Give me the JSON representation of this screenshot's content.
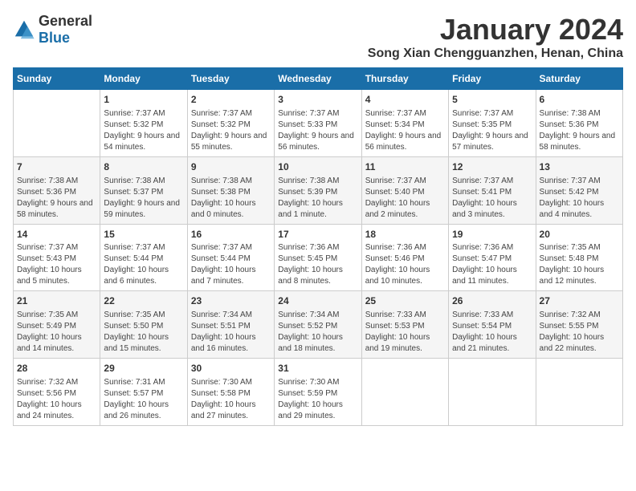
{
  "header": {
    "logo": {
      "general": "General",
      "blue": "Blue"
    },
    "month_year": "January 2024",
    "location": "Song Xian Chengguanzhen, Henan, China"
  },
  "days_of_week": [
    "Sunday",
    "Monday",
    "Tuesday",
    "Wednesday",
    "Thursday",
    "Friday",
    "Saturday"
  ],
  "weeks": [
    [
      {
        "day": "",
        "sunrise": "",
        "sunset": "",
        "daylight": ""
      },
      {
        "day": "1",
        "sunrise": "Sunrise: 7:37 AM",
        "sunset": "Sunset: 5:32 PM",
        "daylight": "Daylight: 9 hours and 54 minutes."
      },
      {
        "day": "2",
        "sunrise": "Sunrise: 7:37 AM",
        "sunset": "Sunset: 5:32 PM",
        "daylight": "Daylight: 9 hours and 55 minutes."
      },
      {
        "day": "3",
        "sunrise": "Sunrise: 7:37 AM",
        "sunset": "Sunset: 5:33 PM",
        "daylight": "Daylight: 9 hours and 56 minutes."
      },
      {
        "day": "4",
        "sunrise": "Sunrise: 7:37 AM",
        "sunset": "Sunset: 5:34 PM",
        "daylight": "Daylight: 9 hours and 56 minutes."
      },
      {
        "day": "5",
        "sunrise": "Sunrise: 7:37 AM",
        "sunset": "Sunset: 5:35 PM",
        "daylight": "Daylight: 9 hours and 57 minutes."
      },
      {
        "day": "6",
        "sunrise": "Sunrise: 7:38 AM",
        "sunset": "Sunset: 5:36 PM",
        "daylight": "Daylight: 9 hours and 58 minutes."
      }
    ],
    [
      {
        "day": "7",
        "sunrise": "Sunrise: 7:38 AM",
        "sunset": "Sunset: 5:36 PM",
        "daylight": "Daylight: 9 hours and 58 minutes."
      },
      {
        "day": "8",
        "sunrise": "Sunrise: 7:38 AM",
        "sunset": "Sunset: 5:37 PM",
        "daylight": "Daylight: 9 hours and 59 minutes."
      },
      {
        "day": "9",
        "sunrise": "Sunrise: 7:38 AM",
        "sunset": "Sunset: 5:38 PM",
        "daylight": "Daylight: 10 hours and 0 minutes."
      },
      {
        "day": "10",
        "sunrise": "Sunrise: 7:38 AM",
        "sunset": "Sunset: 5:39 PM",
        "daylight": "Daylight: 10 hours and 1 minute."
      },
      {
        "day": "11",
        "sunrise": "Sunrise: 7:37 AM",
        "sunset": "Sunset: 5:40 PM",
        "daylight": "Daylight: 10 hours and 2 minutes."
      },
      {
        "day": "12",
        "sunrise": "Sunrise: 7:37 AM",
        "sunset": "Sunset: 5:41 PM",
        "daylight": "Daylight: 10 hours and 3 minutes."
      },
      {
        "day": "13",
        "sunrise": "Sunrise: 7:37 AM",
        "sunset": "Sunset: 5:42 PM",
        "daylight": "Daylight: 10 hours and 4 minutes."
      }
    ],
    [
      {
        "day": "14",
        "sunrise": "Sunrise: 7:37 AM",
        "sunset": "Sunset: 5:43 PM",
        "daylight": "Daylight: 10 hours and 5 minutes."
      },
      {
        "day": "15",
        "sunrise": "Sunrise: 7:37 AM",
        "sunset": "Sunset: 5:44 PM",
        "daylight": "Daylight: 10 hours and 6 minutes."
      },
      {
        "day": "16",
        "sunrise": "Sunrise: 7:37 AM",
        "sunset": "Sunset: 5:44 PM",
        "daylight": "Daylight: 10 hours and 7 minutes."
      },
      {
        "day": "17",
        "sunrise": "Sunrise: 7:36 AM",
        "sunset": "Sunset: 5:45 PM",
        "daylight": "Daylight: 10 hours and 8 minutes."
      },
      {
        "day": "18",
        "sunrise": "Sunrise: 7:36 AM",
        "sunset": "Sunset: 5:46 PM",
        "daylight": "Daylight: 10 hours and 10 minutes."
      },
      {
        "day": "19",
        "sunrise": "Sunrise: 7:36 AM",
        "sunset": "Sunset: 5:47 PM",
        "daylight": "Daylight: 10 hours and 11 minutes."
      },
      {
        "day": "20",
        "sunrise": "Sunrise: 7:35 AM",
        "sunset": "Sunset: 5:48 PM",
        "daylight": "Daylight: 10 hours and 12 minutes."
      }
    ],
    [
      {
        "day": "21",
        "sunrise": "Sunrise: 7:35 AM",
        "sunset": "Sunset: 5:49 PM",
        "daylight": "Daylight: 10 hours and 14 minutes."
      },
      {
        "day": "22",
        "sunrise": "Sunrise: 7:35 AM",
        "sunset": "Sunset: 5:50 PM",
        "daylight": "Daylight: 10 hours and 15 minutes."
      },
      {
        "day": "23",
        "sunrise": "Sunrise: 7:34 AM",
        "sunset": "Sunset: 5:51 PM",
        "daylight": "Daylight: 10 hours and 16 minutes."
      },
      {
        "day": "24",
        "sunrise": "Sunrise: 7:34 AM",
        "sunset": "Sunset: 5:52 PM",
        "daylight": "Daylight: 10 hours and 18 minutes."
      },
      {
        "day": "25",
        "sunrise": "Sunrise: 7:33 AM",
        "sunset": "Sunset: 5:53 PM",
        "daylight": "Daylight: 10 hours and 19 minutes."
      },
      {
        "day": "26",
        "sunrise": "Sunrise: 7:33 AM",
        "sunset": "Sunset: 5:54 PM",
        "daylight": "Daylight: 10 hours and 21 minutes."
      },
      {
        "day": "27",
        "sunrise": "Sunrise: 7:32 AM",
        "sunset": "Sunset: 5:55 PM",
        "daylight": "Daylight: 10 hours and 22 minutes."
      }
    ],
    [
      {
        "day": "28",
        "sunrise": "Sunrise: 7:32 AM",
        "sunset": "Sunset: 5:56 PM",
        "daylight": "Daylight: 10 hours and 24 minutes."
      },
      {
        "day": "29",
        "sunrise": "Sunrise: 7:31 AM",
        "sunset": "Sunset: 5:57 PM",
        "daylight": "Daylight: 10 hours and 26 minutes."
      },
      {
        "day": "30",
        "sunrise": "Sunrise: 7:30 AM",
        "sunset": "Sunset: 5:58 PM",
        "daylight": "Daylight: 10 hours and 27 minutes."
      },
      {
        "day": "31",
        "sunrise": "Sunrise: 7:30 AM",
        "sunset": "Sunset: 5:59 PM",
        "daylight": "Daylight: 10 hours and 29 minutes."
      },
      {
        "day": "",
        "sunrise": "",
        "sunset": "",
        "daylight": ""
      },
      {
        "day": "",
        "sunrise": "",
        "sunset": "",
        "daylight": ""
      },
      {
        "day": "",
        "sunrise": "",
        "sunset": "",
        "daylight": ""
      }
    ]
  ]
}
